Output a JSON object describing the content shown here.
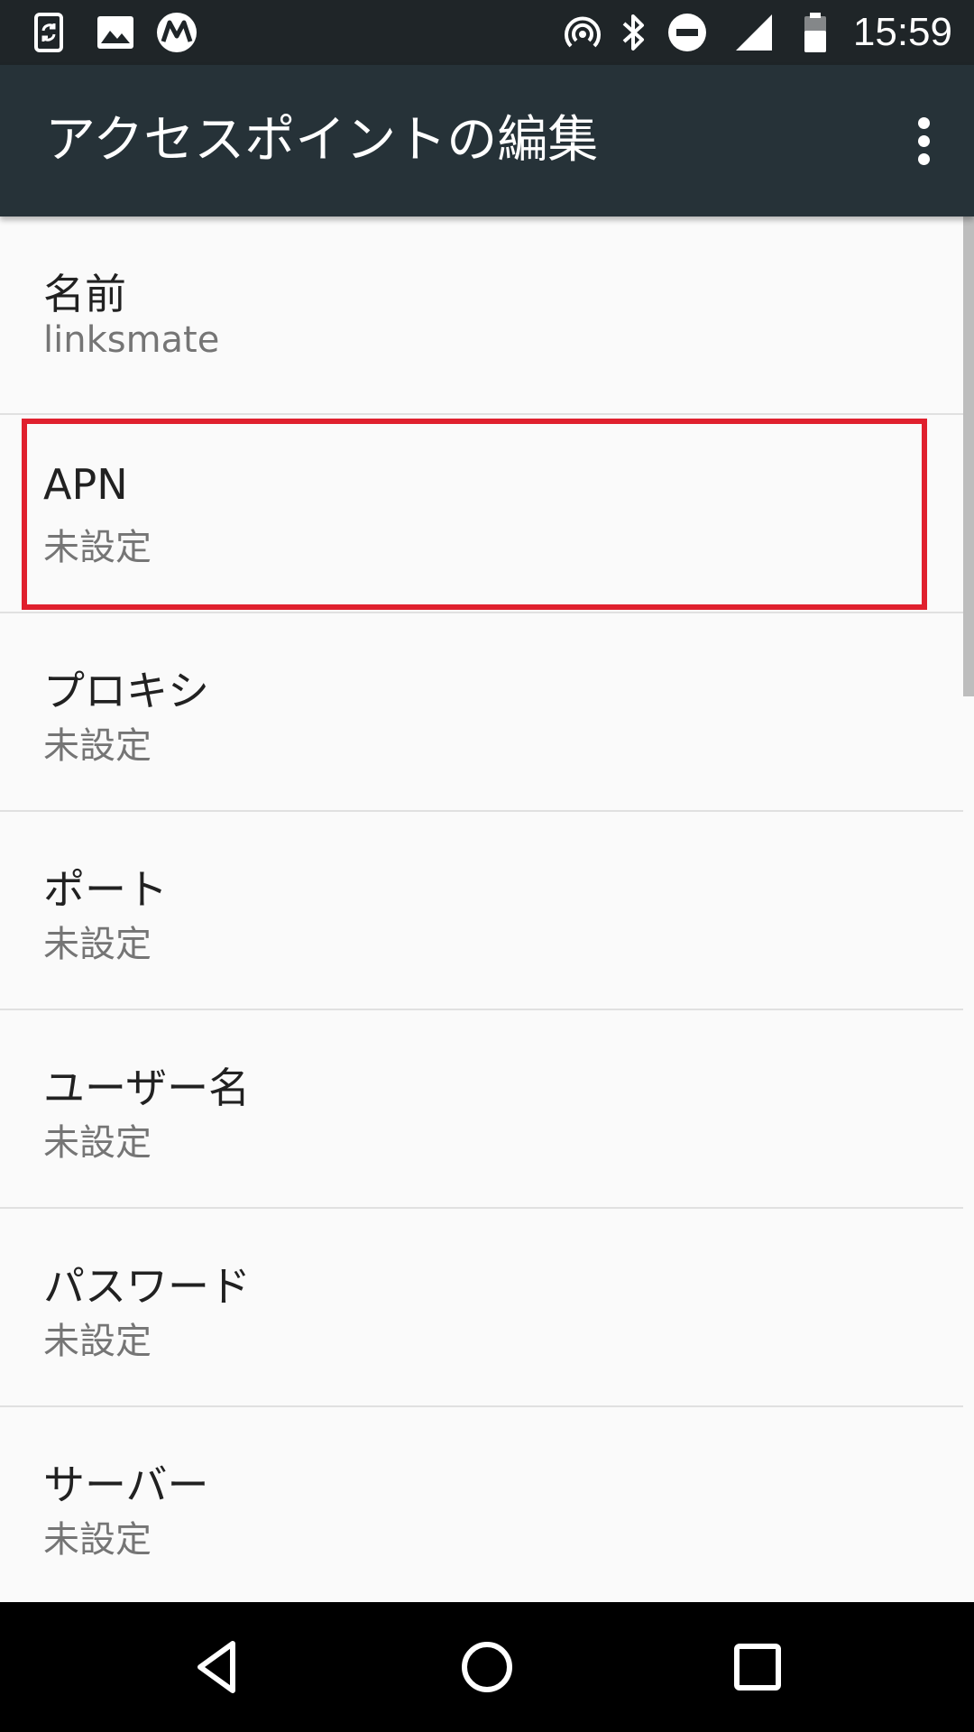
{
  "status_bar": {
    "time": "15:59",
    "icons_left": [
      "phone-sync-icon",
      "image-icon",
      "motorola-icon"
    ],
    "icons_right": [
      "hotspot-icon",
      "bluetooth-icon",
      "do-not-disturb-icon",
      "signal-icon",
      "battery-icon"
    ]
  },
  "app_bar": {
    "title": "アクセスポイントの編集",
    "overflow_icon": "more-vert-icon"
  },
  "list": {
    "items": [
      {
        "title": "名前",
        "value": "linksmate",
        "highlighted": false
      },
      {
        "title": "APN",
        "value": "未設定",
        "highlighted": true
      },
      {
        "title": "プロキシ",
        "value": "未設定",
        "highlighted": false
      },
      {
        "title": "ポート",
        "value": "未設定",
        "highlighted": false
      },
      {
        "title": "ユーザー名",
        "value": "未設定",
        "highlighted": false
      },
      {
        "title": "パスワード",
        "value": "未設定",
        "highlighted": false
      },
      {
        "title": "サーバー",
        "value": "未設定",
        "highlighted": false
      }
    ]
  },
  "nav_bar": {
    "icons": [
      "back-icon",
      "home-icon",
      "recents-icon"
    ]
  },
  "colors": {
    "status_bar": "#1f2528",
    "app_bar": "#263238",
    "background": "#fafafa",
    "highlight_border": "#e0202e"
  }
}
